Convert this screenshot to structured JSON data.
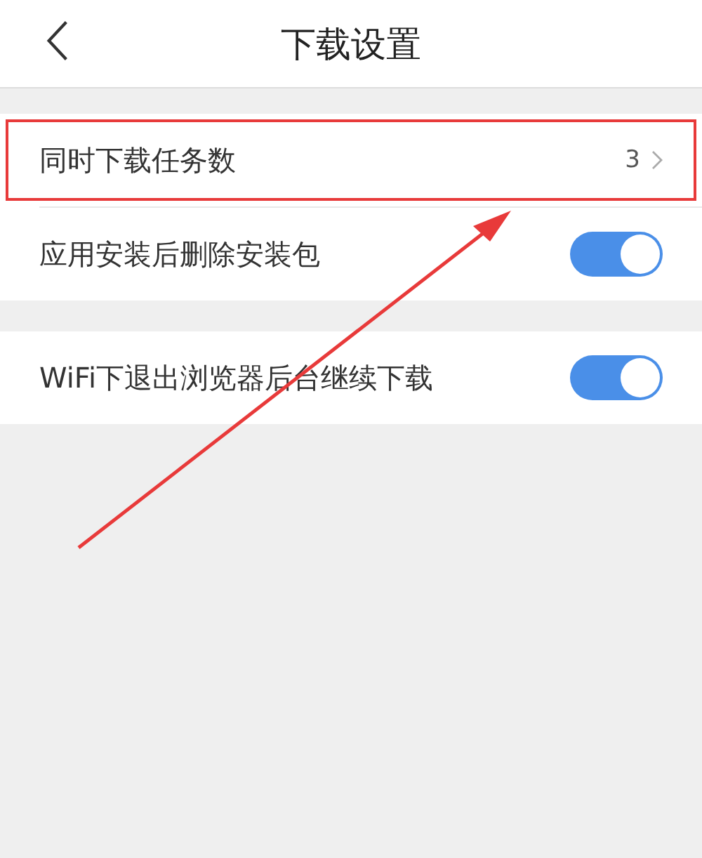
{
  "header": {
    "title": "下载设置"
  },
  "sections": [
    {
      "items": [
        {
          "kind": "value",
          "label": "同时下载任务数",
          "value": "3",
          "highlighted": true
        },
        {
          "kind": "toggle",
          "label": "应用安装后删除安装包",
          "on": true,
          "highlighted": false
        }
      ]
    },
    {
      "items": [
        {
          "kind": "toggle",
          "label": "WiFi下退出浏览器后台继续下载",
          "on": true,
          "highlighted": false
        }
      ]
    }
  ]
}
